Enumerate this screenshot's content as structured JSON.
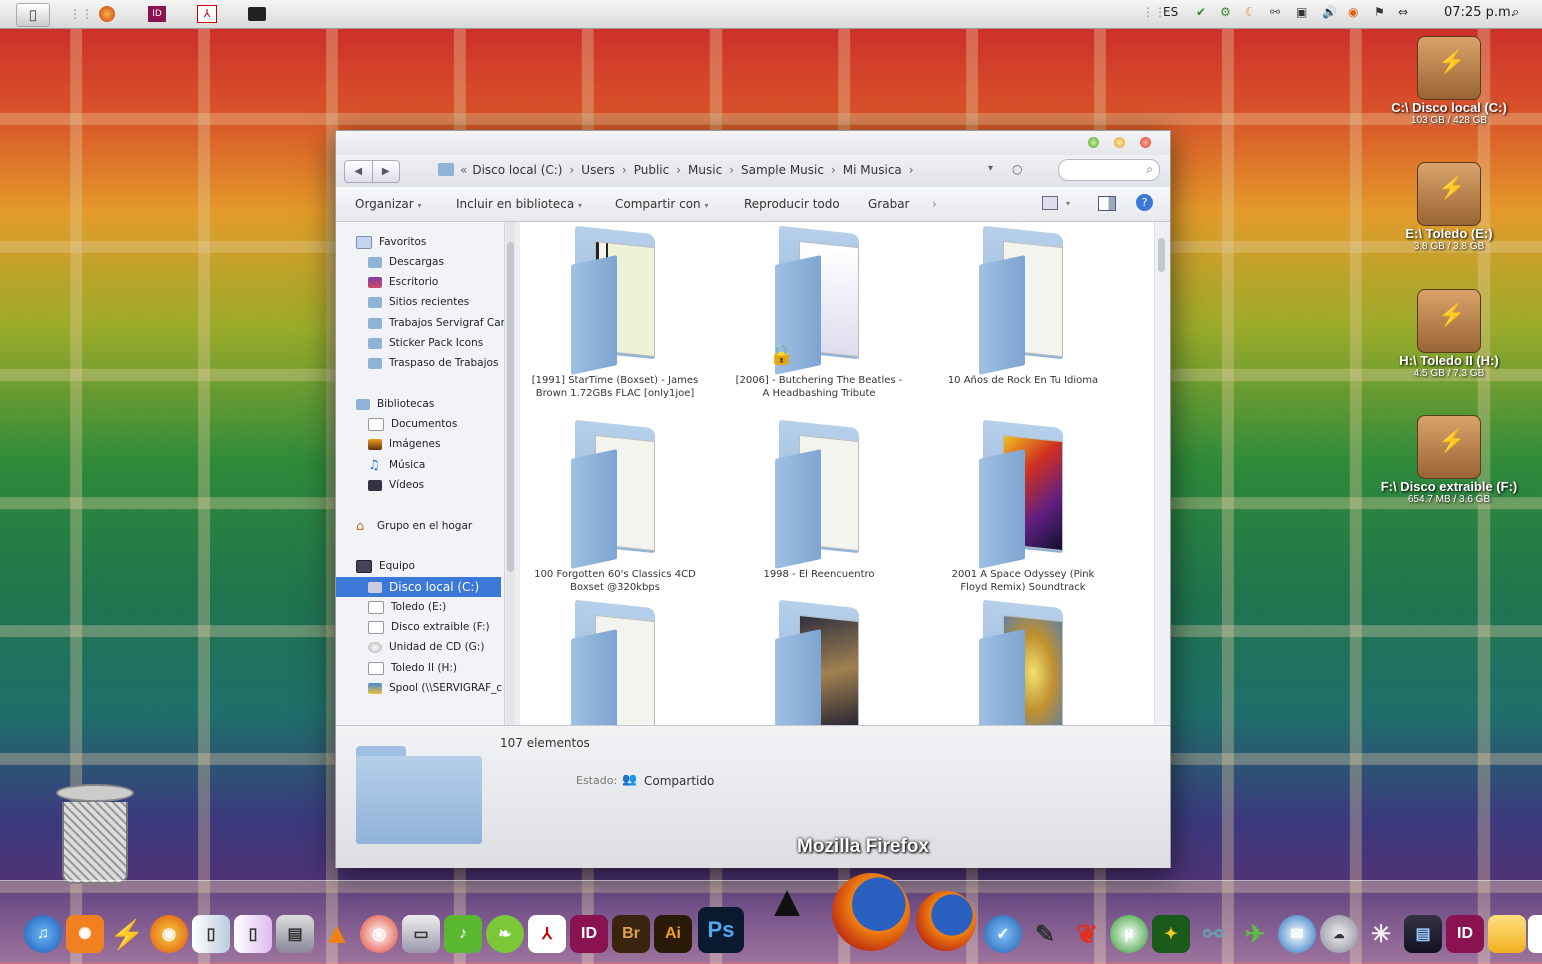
{
  "menubar": {
    "apple": "",
    "tray": {
      "lang": "ES",
      "clock": "07:25 p.m."
    }
  },
  "window": {
    "breadcrumbs": [
      "Disco local (C:)",
      "Users",
      "Public",
      "Music",
      "Sample Music",
      "Mi Musica"
    ],
    "toolbar": {
      "organizar": "Organizar",
      "biblioteca": "Incluir en biblioteca",
      "compartir": "Compartir con",
      "reproducir": "Reproducir todo",
      "grabar": "Grabar"
    },
    "sidebar": {
      "favoritos": "Favoritos",
      "fav_items": [
        "Descargas",
        "Escritorio",
        "Sitios recientes",
        "Trabajos Servigraf Car",
        "Sticker Pack Icons",
        "Traspaso de Trabajos"
      ],
      "bibliotecas": "Bibliotecas",
      "lib_items": [
        "Documentos",
        "Imágenes",
        "Música",
        "Vídeos"
      ],
      "grupo": "Grupo en el hogar",
      "equipo": "Equipo",
      "drives": [
        "Disco local (C:)",
        "Toledo (E:)",
        "Disco extraible (F:)",
        "Unidad de CD (G:)",
        "Toledo II (H:)",
        "Spool (\\\\SERVIGRAF_c"
      ]
    },
    "items": [
      "[1991] StarTime (Boxset) - James Brown 1.72GBs FLAC [only1joe]",
      "[2006] - Butchering The Beatles - A Headbashing Tribute",
      "10 Años de Rock En Tu Idioma",
      "100 Forgotten 60's Classics 4CD Boxset @320kbps",
      "1998 - El Reencuentro",
      "2001 A Space Odyssey (Pink Floyd Remix) Soundtrack",
      "",
      "",
      ""
    ],
    "details": {
      "count": "107 elementos",
      "estado_label": "Estado:",
      "estado_value": "Compartido"
    }
  },
  "firefox_label": "Mozilla Firefox",
  "desktop_drives": [
    {
      "name": "C:\\ Disco local (C:)",
      "size": "103 GB / 428 GB"
    },
    {
      "name": "E:\\ Toledo (E:)",
      "size": "3.8 GB / 3.8 GB"
    },
    {
      "name": "H:\\ Toledo II (H:)",
      "size": "4.5 GB / 7.3 GB"
    },
    {
      "name": "F:\\ Disco extraible (F:)",
      "size": "654.7 MB / 3.6 GB"
    }
  ],
  "dock": [
    "ID",
    "Br",
    "Ai",
    "Ps",
    "ID"
  ],
  "colors": {
    "selection": "#3b78d8",
    "accent_red": "#e0463a",
    "accent_yellow": "#e8b83a",
    "accent_green": "#7ab648"
  }
}
